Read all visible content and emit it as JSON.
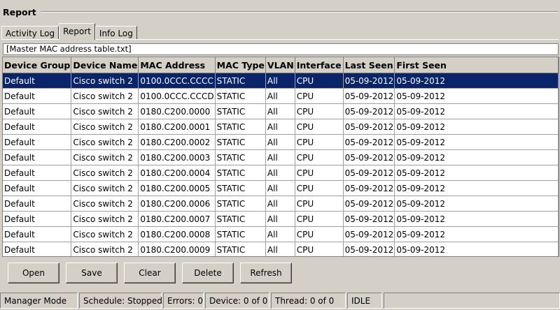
{
  "section": {
    "title": "Report"
  },
  "tabs": [
    {
      "label": "Activity Log",
      "active": false
    },
    {
      "label": "Report",
      "active": true
    },
    {
      "label": "Info Log",
      "active": false
    }
  ],
  "file_label": "[Master MAC address table.txt]",
  "table": {
    "columns": [
      "Device Group",
      "Device Name",
      "MAC Address",
      "MAC Type",
      "VLAN",
      "Interface",
      "Last Seen",
      "First Seen"
    ],
    "rows": [
      [
        "Default",
        "Cisco switch 2",
        "0100.0CCC.CCCC",
        "STATIC",
        "All",
        "CPU",
        "05-09-2012",
        "05-09-2012"
      ],
      [
        "Default",
        "Cisco switch 2",
        "0100.0CCC.CCCD",
        "STATIC",
        "All",
        "CPU",
        "05-09-2012",
        "05-09-2012"
      ],
      [
        "Default",
        "Cisco switch 2",
        "0180.C200.0000",
        "STATIC",
        "All",
        "CPU",
        "05-09-2012",
        "05-09-2012"
      ],
      [
        "Default",
        "Cisco switch 2",
        "0180.C200.0001",
        "STATIC",
        "All",
        "CPU",
        "05-09-2012",
        "05-09-2012"
      ],
      [
        "Default",
        "Cisco switch 2",
        "0180.C200.0002",
        "STATIC",
        "All",
        "CPU",
        "05-09-2012",
        "05-09-2012"
      ],
      [
        "Default",
        "Cisco switch 2",
        "0180.C200.0003",
        "STATIC",
        "All",
        "CPU",
        "05-09-2012",
        "05-09-2012"
      ],
      [
        "Default",
        "Cisco switch 2",
        "0180.C200.0004",
        "STATIC",
        "All",
        "CPU",
        "05-09-2012",
        "05-09-2012"
      ],
      [
        "Default",
        "Cisco switch 2",
        "0180.C200.0005",
        "STATIC",
        "All",
        "CPU",
        "05-09-2012",
        "05-09-2012"
      ],
      [
        "Default",
        "Cisco switch 2",
        "0180.C200.0006",
        "STATIC",
        "All",
        "CPU",
        "05-09-2012",
        "05-09-2012"
      ],
      [
        "Default",
        "Cisco switch 2",
        "0180.C200.0007",
        "STATIC",
        "All",
        "CPU",
        "05-09-2012",
        "05-09-2012"
      ],
      [
        "Default",
        "Cisco switch 2",
        "0180.C200.0008",
        "STATIC",
        "All",
        "CPU",
        "05-09-2012",
        "05-09-2012"
      ],
      [
        "Default",
        "Cisco switch 2",
        "0180.C200.0009",
        "STATIC",
        "All",
        "CPU",
        "05-09-2012",
        "05-09-2012"
      ]
    ],
    "selected_row": 0
  },
  "buttons": {
    "open": "Open",
    "save": "Save",
    "clear": "Clear",
    "delete": "Delete",
    "refresh": "Refresh"
  },
  "status": {
    "mode": "Manager Mode",
    "schedule": "Schedule: Stopped",
    "errors": "Errors: 0",
    "device": "Device: 0 of 0",
    "thread": "Thread: 0 of 0",
    "state": "IDLE"
  },
  "colors": {
    "selection": "#0a246a",
    "window": "#d4d0c8"
  }
}
